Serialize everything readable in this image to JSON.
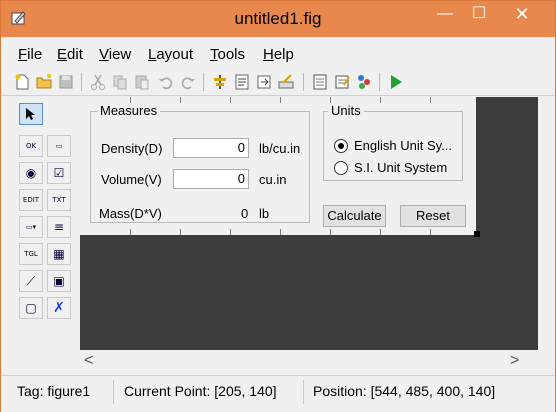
{
  "window": {
    "title": "untitled1.fig",
    "controls": {
      "minimize": "—",
      "maximize": "☐",
      "close": "✕"
    }
  },
  "menu": {
    "items": [
      {
        "label": "File",
        "mnemonic": "F"
      },
      {
        "label": "Edit",
        "mnemonic": "E"
      },
      {
        "label": "View",
        "mnemonic": "V"
      },
      {
        "label": "Layout",
        "mnemonic": "L"
      },
      {
        "label": "Tools",
        "mnemonic": "T"
      },
      {
        "label": "Help",
        "mnemonic": "H"
      }
    ]
  },
  "toolbar": {
    "icons": [
      "new-file-icon",
      "open-folder-icon",
      "save-icon",
      "cut-icon",
      "copy-icon",
      "paste-icon",
      "undo-icon",
      "redo-icon",
      "align-icon",
      "menu-editor-icon",
      "tab-order-icon",
      "toolbar-editor-icon",
      "mfile-editor-icon",
      "property-inspector-icon",
      "object-browser-icon",
      "run-icon"
    ]
  },
  "palette": {
    "tools": [
      {
        "name": "select-tool",
        "text": ""
      },
      {
        "name": "pushbutton-tool",
        "text": "OK"
      },
      {
        "name": "slider-tool",
        "text": "▭"
      },
      {
        "name": "radio-tool",
        "text": "◉"
      },
      {
        "name": "checkbox-tool",
        "text": "☑"
      },
      {
        "name": "edit-text-tool",
        "text": "EDIT"
      },
      {
        "name": "static-text-tool",
        "text": "TXT"
      },
      {
        "name": "popup-menu-tool",
        "text": "▭▾"
      },
      {
        "name": "listbox-tool",
        "text": "≡"
      },
      {
        "name": "toggle-tool",
        "text": "TGL"
      },
      {
        "name": "table-tool",
        "text": "▦"
      },
      {
        "name": "axes-tool",
        "text": "⟋"
      },
      {
        "name": "panel-tool",
        "text": "▣"
      },
      {
        "name": "button-group-tool",
        "text": "▢"
      },
      {
        "name": "activex-tool",
        "text": "✗"
      }
    ]
  },
  "figure": {
    "measures_panel": {
      "title": "Measures",
      "density_label": "Density(D)",
      "density_value": "0",
      "density_unit": "lb/cu.in",
      "volume_label": "Volume(V)",
      "volume_value": "0",
      "volume_unit": "cu.in",
      "mass_label": "Mass(D*V)",
      "mass_value": "0",
      "mass_unit": "lb"
    },
    "units_panel": {
      "title": "Units",
      "english_label": "English Unit Sy...",
      "english_selected": true,
      "si_label": "S.I. Unit System",
      "si_selected": false
    },
    "calculate_label": "Calculate",
    "reset_label": "Reset"
  },
  "scroll": {
    "left": "<",
    "right": ">"
  },
  "status": {
    "tag": "Tag: figure1",
    "current_point": "Current Point:  [205, 140]",
    "position": "Position: [544, 485, 400, 140]"
  }
}
